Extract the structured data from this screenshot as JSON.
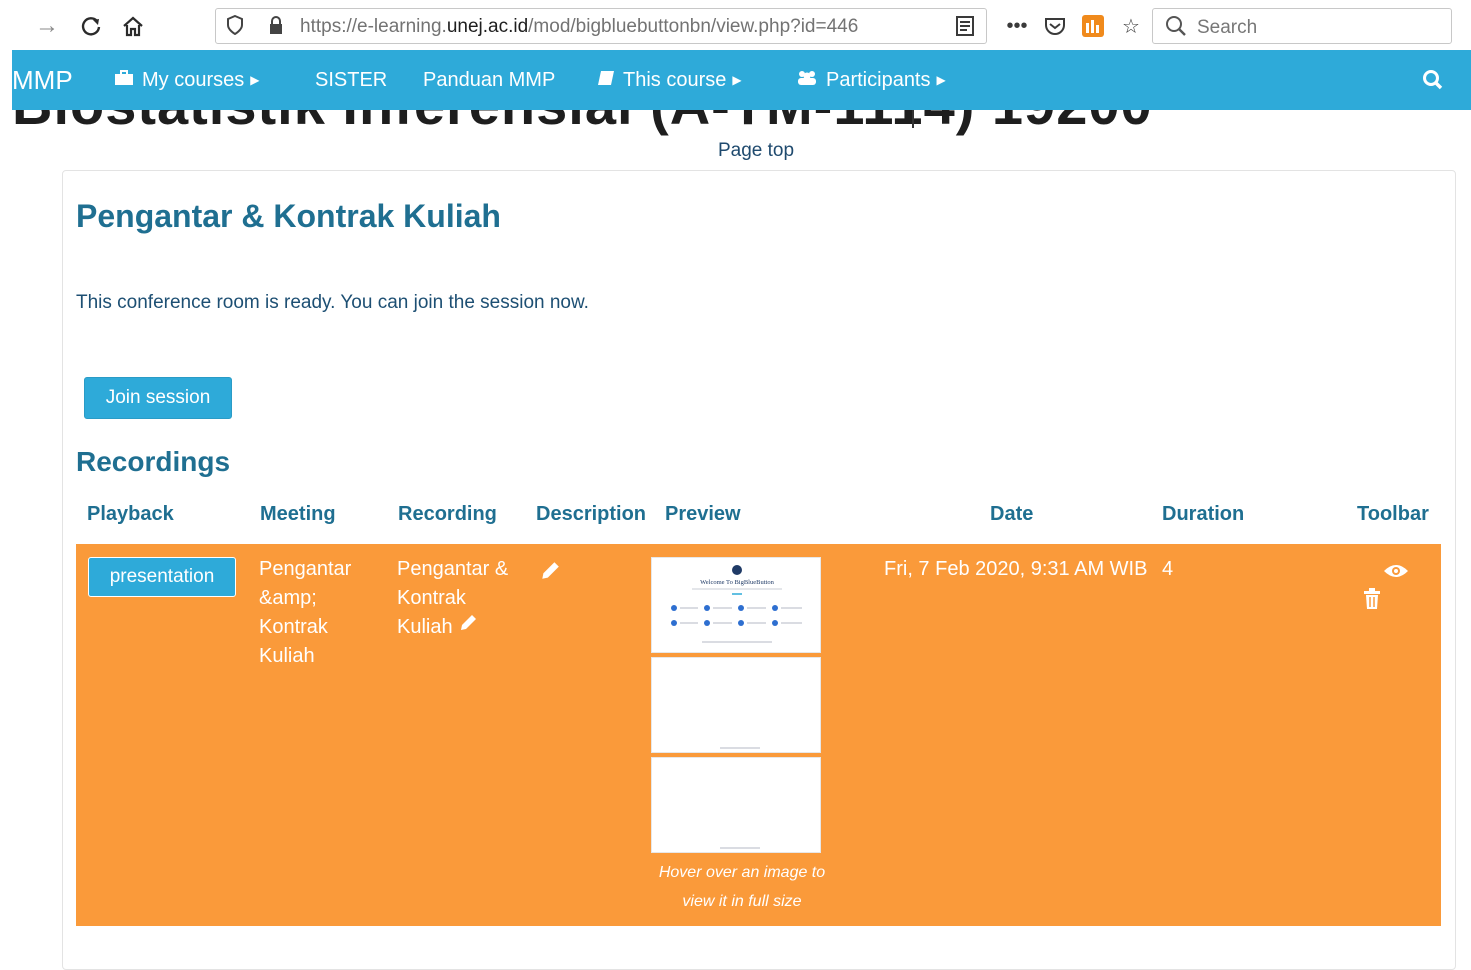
{
  "browser": {
    "url_prefix": "https://e-learning.",
    "url_domain": "unej.ac.id",
    "url_suffix": "/mod/bigbluebuttonbn/view.php?id=446",
    "search_placeholder": "Search"
  },
  "navbar": {
    "brand": "MMP",
    "items": [
      {
        "label": "My courses"
      },
      {
        "label": "SISTER"
      },
      {
        "label": "Panduan MMP"
      },
      {
        "label": "This course"
      },
      {
        "label": "Participants"
      }
    ]
  },
  "page": {
    "heading_fragment": "Biostatistik Inferensial (A-TM-1114) 19200",
    "page_top_link": "Page top",
    "activity_title": "Pengantar & Kontrak Kuliah",
    "status": "This conference room is ready. You can join the session now.",
    "join_button": "Join session",
    "recordings_title": "Recordings"
  },
  "table": {
    "headers": [
      "Playback",
      "Meeting",
      "Recording",
      "Description",
      "Preview",
      "Date",
      "Duration",
      "Toolbar"
    ],
    "row": {
      "playback": "presentation",
      "meeting": "Pengantar &amp; Kontrak Kuliah",
      "recording": "Pengantar & Kontrak Kuliah",
      "date": "Fri, 7 Feb 2020, 9:31 AM WIB",
      "duration": "4",
      "preview_caption": "Hover over an image to view it in full size",
      "thumbnail_title": "Welcome To BigBlueButton"
    }
  },
  "colors": {
    "navbar": "#2eaad9",
    "row_highlight": "#fa9a3a",
    "heading": "#1f6f91"
  }
}
